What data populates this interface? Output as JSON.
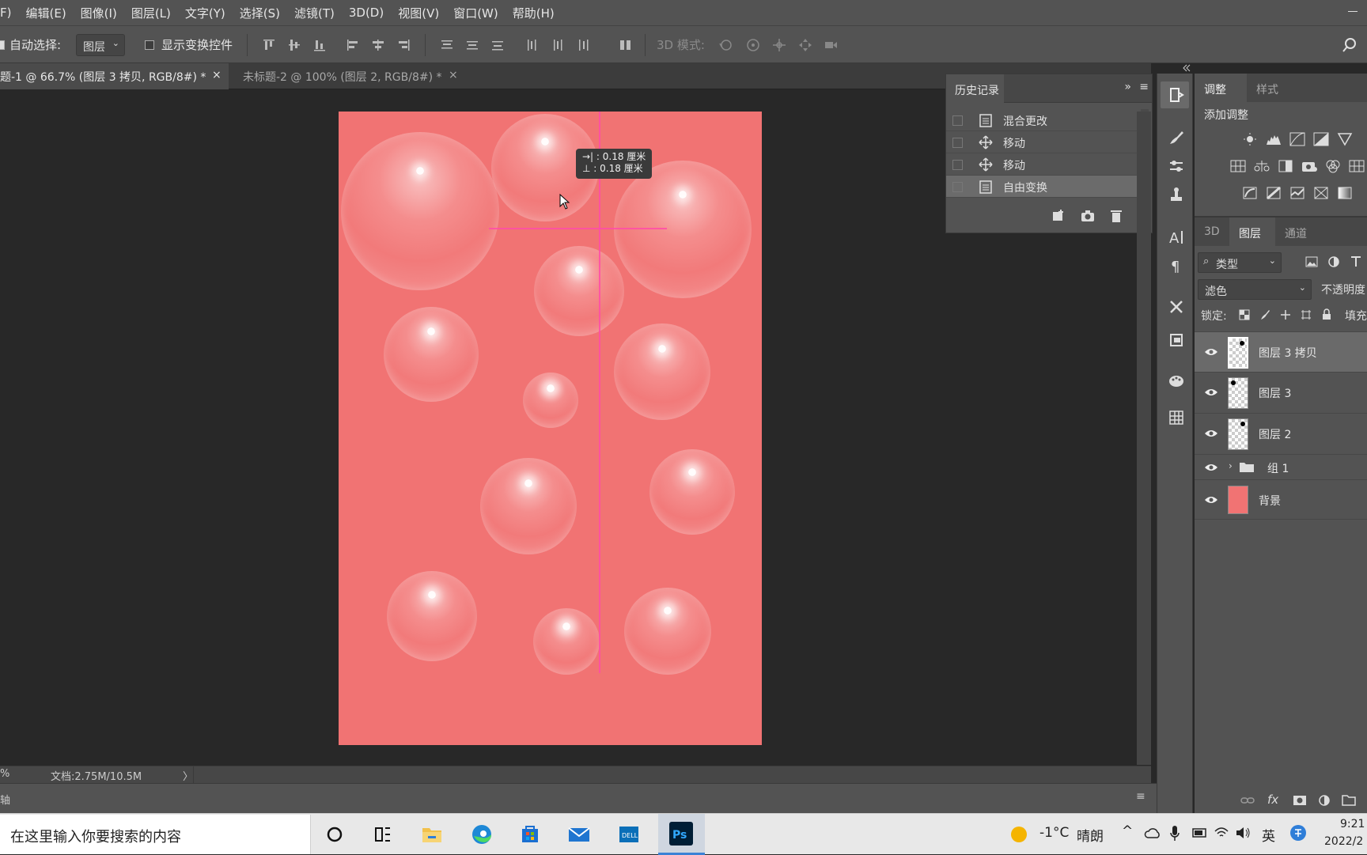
{
  "menu": [
    "F)",
    "编辑(E)",
    "图像(I)",
    "图层(L)",
    "文字(Y)",
    "选择(S)",
    "滤镜(T)",
    "3D(D)",
    "视图(V)",
    "窗口(W)",
    "帮助(H)"
  ],
  "options": {
    "auto_select_label": "自动选择:",
    "auto_select_value": "图层",
    "show_transform_label": "显示变换控件",
    "mode_3d_label": "3D 模式:"
  },
  "tabs": [
    {
      "label": "题-1 @ 66.7% (图层 3 拷贝, RGB/8#) *",
      "close": "×"
    },
    {
      "label": "未标题-2 @ 100% (图层 2, RGB/8#) *",
      "close": "×"
    }
  ],
  "tooltip": {
    "line1": "→| : 0.18 厘米",
    "line2": "⊥ : 0.18 厘米"
  },
  "history": {
    "title": "历史记录",
    "items": [
      "混合更改",
      "移动",
      "移动",
      "自由变换"
    ]
  },
  "adjustments": {
    "tabs": [
      "调整",
      "样式"
    ],
    "add_label": "添加调整"
  },
  "layers_panel": {
    "tabs": [
      "3D",
      "图层",
      "通道"
    ],
    "filter": "类型",
    "blend_mode": "滤色",
    "opacity_label": "不透明度",
    "lock_label": "锁定:",
    "fill_label": "填充",
    "layers": [
      {
        "name": "图层 3 拷贝",
        "selected": true
      },
      {
        "name": "图层 3",
        "selected": false
      },
      {
        "name": "图层 2",
        "selected": false
      },
      {
        "name": "组 1",
        "group": true
      },
      {
        "name": "背景",
        "background": true
      }
    ]
  },
  "status": {
    "zoom_tail": "%",
    "doc_size": "文档:2.75M/10.5M",
    "timeline_tail": "轴"
  },
  "taskbar": {
    "search_placeholder": "在这里输入你要搜索的内容",
    "weather_temp": "-1°C",
    "weather_text": "晴朗",
    "ime": "英",
    "time": "9:21",
    "date": "2022/2"
  },
  "colors": {
    "canvas": "#f17373",
    "guide": "#ff4ca8",
    "panel": "#535353"
  }
}
